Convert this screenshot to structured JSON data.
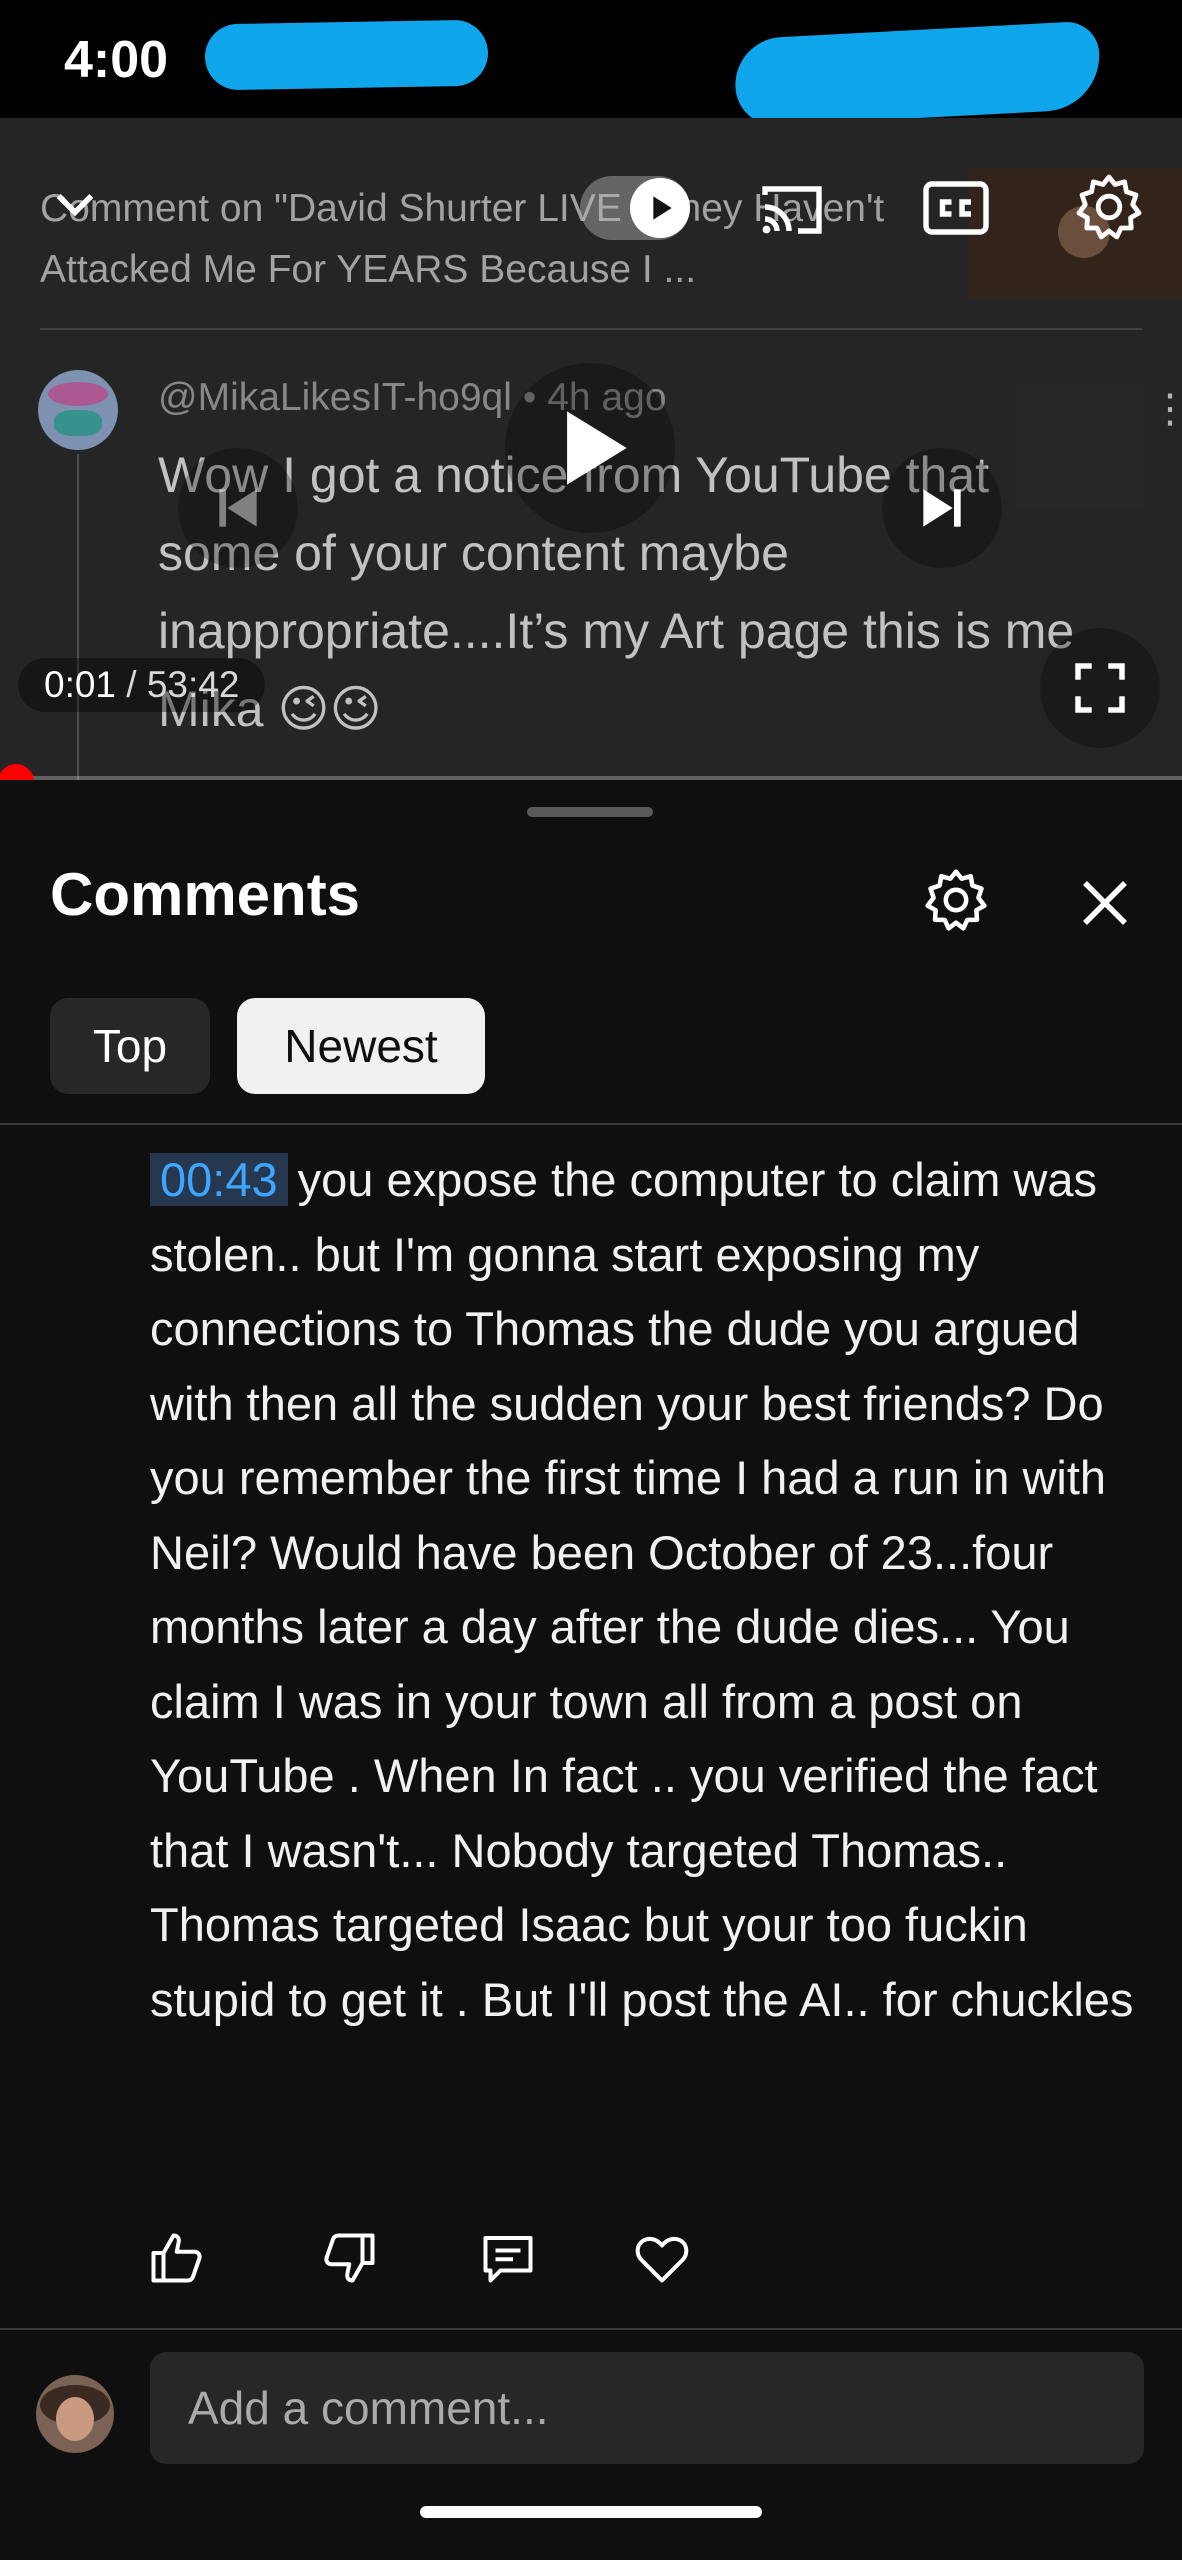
{
  "status_bar": {
    "time": "4:00"
  },
  "player": {
    "comment_on_title": "Comment on \"David Shurter LIVE - They Haven't Attacked Me For YEARS Because I ...",
    "pinned_comment": {
      "author": "@MikaLikesIT-ho9ql",
      "age": "4h ago",
      "text": "Wow I got a notice from YouTube that some of your content maybe inappropriate....It’s my Art page this is me Mika 😉😉"
    },
    "time_current": "0:01",
    "time_separator": " / ",
    "time_total": "53:42",
    "progress_fraction": 0.0003
  },
  "comments_panel": {
    "title": "Comments",
    "tabs": [
      {
        "label": "Top",
        "selected": false
      },
      {
        "label": "Newest",
        "selected": true
      }
    ],
    "comment": {
      "timestamp": "00:43",
      "text": "you expose the  computer to claim was stolen.. but I'm gonna start exposing my connections to Thomas the dude you argued with then all the sudden your best friends? Do you remember the first time I had a run in with Neil? Would have been October of 23...four months later a day after the dude dies... You claim I was in your town all from a post on YouTube . When In fact ..  you verified the fact that I wasn't... Nobody targeted Thomas.. Thomas targeted Isaac but your too fuckin stupid to get it . But I'll post the AI.. for chuckles"
    },
    "add_comment_placeholder": "Add a comment..."
  },
  "colors": {
    "background": "#0f0f0f",
    "progress": "#ff0000",
    "timestamp_link": "#3ea6ff",
    "redaction": "#10a6ec"
  },
  "icons": [
    "chevron-down-icon",
    "autoplay-toggle",
    "cast-icon",
    "cc-icon",
    "gear-icon",
    "previous-icon",
    "play-icon",
    "next-icon",
    "fullscreen-icon",
    "close-icon",
    "thumb-up-icon",
    "thumb-down-icon",
    "reply-icon",
    "heart-icon",
    "more-vert-icon"
  ]
}
